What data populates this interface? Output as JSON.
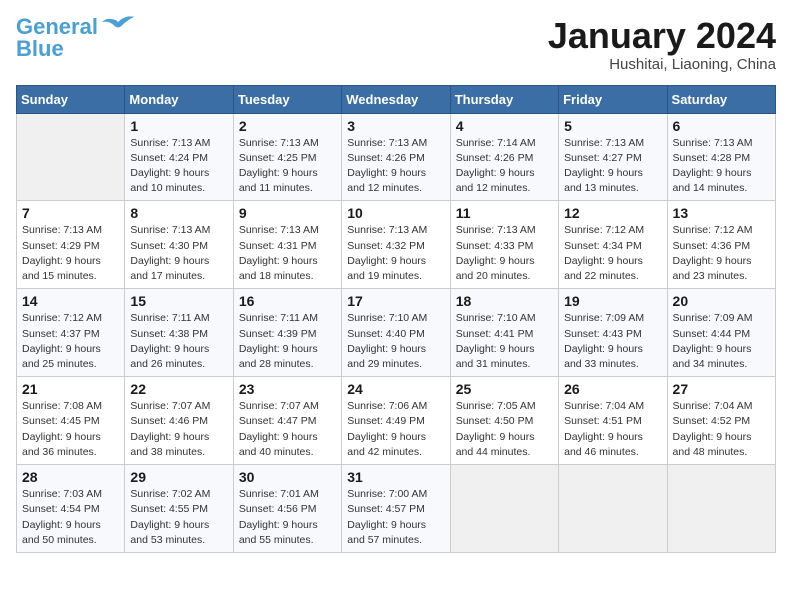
{
  "header": {
    "logo_line1": "General",
    "logo_line2": "Blue",
    "month": "January 2024",
    "location": "Hushitai, Liaoning, China"
  },
  "weekdays": [
    "Sunday",
    "Monday",
    "Tuesday",
    "Wednesday",
    "Thursday",
    "Friday",
    "Saturday"
  ],
  "weeks": [
    [
      {
        "day": "",
        "info": ""
      },
      {
        "day": "1",
        "info": "Sunrise: 7:13 AM\nSunset: 4:24 PM\nDaylight: 9 hours\nand 10 minutes."
      },
      {
        "day": "2",
        "info": "Sunrise: 7:13 AM\nSunset: 4:25 PM\nDaylight: 9 hours\nand 11 minutes."
      },
      {
        "day": "3",
        "info": "Sunrise: 7:13 AM\nSunset: 4:26 PM\nDaylight: 9 hours\nand 12 minutes."
      },
      {
        "day": "4",
        "info": "Sunrise: 7:14 AM\nSunset: 4:26 PM\nDaylight: 9 hours\nand 12 minutes."
      },
      {
        "day": "5",
        "info": "Sunrise: 7:13 AM\nSunset: 4:27 PM\nDaylight: 9 hours\nand 13 minutes."
      },
      {
        "day": "6",
        "info": "Sunrise: 7:13 AM\nSunset: 4:28 PM\nDaylight: 9 hours\nand 14 minutes."
      }
    ],
    [
      {
        "day": "7",
        "info": "Sunrise: 7:13 AM\nSunset: 4:29 PM\nDaylight: 9 hours\nand 15 minutes."
      },
      {
        "day": "8",
        "info": "Sunrise: 7:13 AM\nSunset: 4:30 PM\nDaylight: 9 hours\nand 17 minutes."
      },
      {
        "day": "9",
        "info": "Sunrise: 7:13 AM\nSunset: 4:31 PM\nDaylight: 9 hours\nand 18 minutes."
      },
      {
        "day": "10",
        "info": "Sunrise: 7:13 AM\nSunset: 4:32 PM\nDaylight: 9 hours\nand 19 minutes."
      },
      {
        "day": "11",
        "info": "Sunrise: 7:13 AM\nSunset: 4:33 PM\nDaylight: 9 hours\nand 20 minutes."
      },
      {
        "day": "12",
        "info": "Sunrise: 7:12 AM\nSunset: 4:34 PM\nDaylight: 9 hours\nand 22 minutes."
      },
      {
        "day": "13",
        "info": "Sunrise: 7:12 AM\nSunset: 4:36 PM\nDaylight: 9 hours\nand 23 minutes."
      }
    ],
    [
      {
        "day": "14",
        "info": "Sunrise: 7:12 AM\nSunset: 4:37 PM\nDaylight: 9 hours\nand 25 minutes."
      },
      {
        "day": "15",
        "info": "Sunrise: 7:11 AM\nSunset: 4:38 PM\nDaylight: 9 hours\nand 26 minutes."
      },
      {
        "day": "16",
        "info": "Sunrise: 7:11 AM\nSunset: 4:39 PM\nDaylight: 9 hours\nand 28 minutes."
      },
      {
        "day": "17",
        "info": "Sunrise: 7:10 AM\nSunset: 4:40 PM\nDaylight: 9 hours\nand 29 minutes."
      },
      {
        "day": "18",
        "info": "Sunrise: 7:10 AM\nSunset: 4:41 PM\nDaylight: 9 hours\nand 31 minutes."
      },
      {
        "day": "19",
        "info": "Sunrise: 7:09 AM\nSunset: 4:43 PM\nDaylight: 9 hours\nand 33 minutes."
      },
      {
        "day": "20",
        "info": "Sunrise: 7:09 AM\nSunset: 4:44 PM\nDaylight: 9 hours\nand 34 minutes."
      }
    ],
    [
      {
        "day": "21",
        "info": "Sunrise: 7:08 AM\nSunset: 4:45 PM\nDaylight: 9 hours\nand 36 minutes."
      },
      {
        "day": "22",
        "info": "Sunrise: 7:07 AM\nSunset: 4:46 PM\nDaylight: 9 hours\nand 38 minutes."
      },
      {
        "day": "23",
        "info": "Sunrise: 7:07 AM\nSunset: 4:47 PM\nDaylight: 9 hours\nand 40 minutes."
      },
      {
        "day": "24",
        "info": "Sunrise: 7:06 AM\nSunset: 4:49 PM\nDaylight: 9 hours\nand 42 minutes."
      },
      {
        "day": "25",
        "info": "Sunrise: 7:05 AM\nSunset: 4:50 PM\nDaylight: 9 hours\nand 44 minutes."
      },
      {
        "day": "26",
        "info": "Sunrise: 7:04 AM\nSunset: 4:51 PM\nDaylight: 9 hours\nand 46 minutes."
      },
      {
        "day": "27",
        "info": "Sunrise: 7:04 AM\nSunset: 4:52 PM\nDaylight: 9 hours\nand 48 minutes."
      }
    ],
    [
      {
        "day": "28",
        "info": "Sunrise: 7:03 AM\nSunset: 4:54 PM\nDaylight: 9 hours\nand 50 minutes."
      },
      {
        "day": "29",
        "info": "Sunrise: 7:02 AM\nSunset: 4:55 PM\nDaylight: 9 hours\nand 53 minutes."
      },
      {
        "day": "30",
        "info": "Sunrise: 7:01 AM\nSunset: 4:56 PM\nDaylight: 9 hours\nand 55 minutes."
      },
      {
        "day": "31",
        "info": "Sunrise: 7:00 AM\nSunset: 4:57 PM\nDaylight: 9 hours\nand 57 minutes."
      },
      {
        "day": "",
        "info": ""
      },
      {
        "day": "",
        "info": ""
      },
      {
        "day": "",
        "info": ""
      }
    ]
  ]
}
